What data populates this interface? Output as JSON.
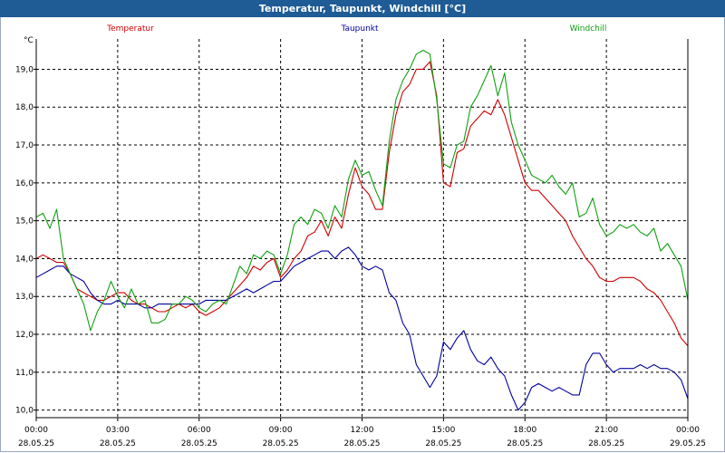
{
  "title": "Temperatur, Taupunkt, Windchill [°C]",
  "chart_data": {
    "type": "line",
    "title": "Temperatur, Taupunkt, Windchill [°C]",
    "ylabel": "°C",
    "xlabel": "",
    "xlim": [
      0,
      24
    ],
    "ylim": [
      9.8,
      19.8
    ],
    "grid": true,
    "legend_position": "top",
    "y_ticks": [
      "10,0",
      "11,0",
      "12,0",
      "13,0",
      "14,0",
      "15,0",
      "16,0",
      "17,0",
      "18,0",
      "19,0"
    ],
    "y_tick_values": [
      10,
      11,
      12,
      13,
      14,
      15,
      16,
      17,
      18,
      19
    ],
    "x_ticks": [
      {
        "time": "00:00",
        "date": "28.05.25"
      },
      {
        "time": "03:00",
        "date": "28.05.25"
      },
      {
        "time": "06:00",
        "date": "28.05.25"
      },
      {
        "time": "09:00",
        "date": "28.05.25"
      },
      {
        "time": "12:00",
        "date": "28.05.25"
      },
      {
        "time": "15:00",
        "date": "28.05.25"
      },
      {
        "time": "18:00",
        "date": "28.05.25"
      },
      {
        "time": "21:00",
        "date": "28.05.25"
      },
      {
        "time": "00:00",
        "date": "29.05.25"
      }
    ],
    "x_tick_values": [
      0,
      3,
      6,
      9,
      12,
      15,
      18,
      21,
      24
    ],
    "series": [
      {
        "name": "Temperatur",
        "color": "#d00000",
        "points": [
          [
            0,
            14.0
          ],
          [
            0.25,
            14.1
          ],
          [
            0.5,
            14.0
          ],
          [
            0.75,
            13.9
          ],
          [
            1.0,
            13.9
          ],
          [
            1.25,
            13.6
          ],
          [
            1.5,
            13.2
          ],
          [
            1.75,
            13.1
          ],
          [
            2.0,
            13.0
          ],
          [
            2.25,
            12.9
          ],
          [
            2.5,
            12.9
          ],
          [
            2.75,
            13.0
          ],
          [
            3.0,
            13.1
          ],
          [
            3.25,
            13.1
          ],
          [
            3.5,
            12.9
          ],
          [
            3.75,
            12.8
          ],
          [
            4.0,
            12.8
          ],
          [
            4.25,
            12.7
          ],
          [
            4.5,
            12.6
          ],
          [
            4.75,
            12.6
          ],
          [
            5.0,
            12.7
          ],
          [
            5.25,
            12.8
          ],
          [
            5.5,
            12.7
          ],
          [
            5.75,
            12.8
          ],
          [
            6.0,
            12.6
          ],
          [
            6.25,
            12.5
          ],
          [
            6.5,
            12.6
          ],
          [
            6.75,
            12.7
          ],
          [
            7.0,
            12.9
          ],
          [
            7.25,
            13.1
          ],
          [
            7.5,
            13.3
          ],
          [
            7.75,
            13.5
          ],
          [
            8.0,
            13.8
          ],
          [
            8.25,
            13.7
          ],
          [
            8.5,
            13.9
          ],
          [
            8.75,
            14.0
          ],
          [
            9.0,
            13.5
          ],
          [
            9.25,
            13.7
          ],
          [
            9.5,
            14.0
          ],
          [
            9.75,
            14.2
          ],
          [
            10.0,
            14.6
          ],
          [
            10.25,
            14.7
          ],
          [
            10.5,
            15.0
          ],
          [
            10.75,
            14.6
          ],
          [
            11.0,
            15.1
          ],
          [
            11.25,
            14.8
          ],
          [
            11.5,
            15.7
          ],
          [
            11.75,
            16.4
          ],
          [
            12.0,
            15.9
          ],
          [
            12.25,
            15.7
          ],
          [
            12.5,
            15.3
          ],
          [
            12.75,
            15.3
          ],
          [
            13.0,
            16.8
          ],
          [
            13.25,
            17.8
          ],
          [
            13.5,
            18.4
          ],
          [
            13.75,
            18.6
          ],
          [
            14.0,
            19.0
          ],
          [
            14.25,
            19.0
          ],
          [
            14.5,
            19.2
          ],
          [
            14.75,
            18.3
          ],
          [
            15.0,
            16.0
          ],
          [
            15.25,
            15.9
          ],
          [
            15.5,
            16.8
          ],
          [
            15.75,
            16.9
          ],
          [
            16.0,
            17.5
          ],
          [
            16.25,
            17.7
          ],
          [
            16.5,
            17.9
          ],
          [
            16.75,
            17.8
          ],
          [
            17.0,
            18.2
          ],
          [
            17.25,
            17.8
          ],
          [
            17.5,
            17.2
          ],
          [
            17.75,
            16.6
          ],
          [
            18.0,
            16.0
          ],
          [
            18.25,
            15.8
          ],
          [
            18.5,
            15.8
          ],
          [
            18.75,
            15.6
          ],
          [
            19.0,
            15.4
          ],
          [
            19.25,
            15.2
          ],
          [
            19.5,
            15.0
          ],
          [
            19.75,
            14.6
          ],
          [
            20.0,
            14.3
          ],
          [
            20.25,
            14.0
          ],
          [
            20.5,
            13.8
          ],
          [
            20.75,
            13.5
          ],
          [
            21.0,
            13.4
          ],
          [
            21.25,
            13.4
          ],
          [
            21.5,
            13.5
          ],
          [
            21.75,
            13.5
          ],
          [
            22.0,
            13.5
          ],
          [
            22.25,
            13.4
          ],
          [
            22.5,
            13.2
          ],
          [
            22.75,
            13.1
          ],
          [
            23.0,
            12.9
          ],
          [
            23.25,
            12.6
          ],
          [
            23.5,
            12.3
          ],
          [
            23.75,
            11.9
          ],
          [
            24.0,
            11.7
          ]
        ]
      },
      {
        "name": "Taupunkt",
        "color": "#0000a0",
        "points": [
          [
            0,
            13.5
          ],
          [
            0.25,
            13.6
          ],
          [
            0.5,
            13.7
          ],
          [
            0.75,
            13.8
          ],
          [
            1.0,
            13.8
          ],
          [
            1.25,
            13.6
          ],
          [
            1.5,
            13.5
          ],
          [
            1.75,
            13.4
          ],
          [
            2.0,
            13.1
          ],
          [
            2.25,
            12.9
          ],
          [
            2.5,
            12.8
          ],
          [
            2.75,
            12.8
          ],
          [
            3.0,
            12.9
          ],
          [
            3.25,
            12.8
          ],
          [
            3.5,
            12.8
          ],
          [
            3.75,
            12.8
          ],
          [
            4.0,
            12.7
          ],
          [
            4.25,
            12.7
          ],
          [
            4.5,
            12.8
          ],
          [
            4.75,
            12.8
          ],
          [
            5.0,
            12.8
          ],
          [
            5.25,
            12.8
          ],
          [
            5.5,
            12.8
          ],
          [
            5.75,
            12.8
          ],
          [
            6.0,
            12.8
          ],
          [
            6.25,
            12.9
          ],
          [
            6.5,
            12.9
          ],
          [
            6.75,
            12.9
          ],
          [
            7.0,
            12.9
          ],
          [
            7.25,
            13.0
          ],
          [
            7.5,
            13.1
          ],
          [
            7.75,
            13.2
          ],
          [
            8.0,
            13.1
          ],
          [
            8.25,
            13.2
          ],
          [
            8.5,
            13.3
          ],
          [
            8.75,
            13.4
          ],
          [
            9.0,
            13.4
          ],
          [
            9.25,
            13.6
          ],
          [
            9.5,
            13.8
          ],
          [
            9.75,
            13.9
          ],
          [
            10.0,
            14.0
          ],
          [
            10.25,
            14.1
          ],
          [
            10.5,
            14.2
          ],
          [
            10.75,
            14.2
          ],
          [
            11.0,
            14.0
          ],
          [
            11.25,
            14.2
          ],
          [
            11.5,
            14.3
          ],
          [
            11.75,
            14.1
          ],
          [
            12.0,
            13.8
          ],
          [
            12.25,
            13.7
          ],
          [
            12.5,
            13.8
          ],
          [
            12.75,
            13.7
          ],
          [
            13.0,
            13.1
          ],
          [
            13.25,
            12.9
          ],
          [
            13.5,
            12.3
          ],
          [
            13.75,
            12.0
          ],
          [
            14.0,
            11.2
          ],
          [
            14.25,
            10.9
          ],
          [
            14.5,
            10.6
          ],
          [
            14.75,
            10.9
          ],
          [
            15.0,
            11.8
          ],
          [
            15.25,
            11.6
          ],
          [
            15.5,
            11.9
          ],
          [
            15.75,
            12.1
          ],
          [
            16.0,
            11.6
          ],
          [
            16.25,
            11.3
          ],
          [
            16.5,
            11.2
          ],
          [
            16.75,
            11.4
          ],
          [
            17.0,
            11.1
          ],
          [
            17.25,
            10.9
          ],
          [
            17.5,
            10.4
          ],
          [
            17.75,
            10.0
          ],
          [
            18.0,
            10.2
          ],
          [
            18.25,
            10.6
          ],
          [
            18.5,
            10.7
          ],
          [
            18.75,
            10.6
          ],
          [
            19.0,
            10.5
          ],
          [
            19.25,
            10.6
          ],
          [
            19.5,
            10.5
          ],
          [
            19.75,
            10.4
          ],
          [
            20.0,
            10.4
          ],
          [
            20.25,
            11.2
          ],
          [
            20.5,
            11.5
          ],
          [
            20.75,
            11.5
          ],
          [
            21.0,
            11.2
          ],
          [
            21.25,
            11.0
          ],
          [
            21.5,
            11.1
          ],
          [
            21.75,
            11.1
          ],
          [
            22.0,
            11.1
          ],
          [
            22.25,
            11.2
          ],
          [
            22.5,
            11.1
          ],
          [
            22.75,
            11.2
          ],
          [
            23.0,
            11.1
          ],
          [
            23.25,
            11.1
          ],
          [
            23.5,
            11.0
          ],
          [
            23.75,
            10.8
          ],
          [
            24.0,
            10.3
          ]
        ]
      },
      {
        "name": "Windchill",
        "color": "#10a010",
        "points": [
          [
            0,
            15.1
          ],
          [
            0.25,
            15.2
          ],
          [
            0.5,
            14.8
          ],
          [
            0.75,
            15.3
          ],
          [
            1.0,
            14.0
          ],
          [
            1.25,
            13.6
          ],
          [
            1.5,
            13.2
          ],
          [
            1.75,
            12.8
          ],
          [
            2.0,
            12.1
          ],
          [
            2.25,
            12.6
          ],
          [
            2.5,
            12.9
          ],
          [
            2.75,
            13.4
          ],
          [
            3.0,
            13.0
          ],
          [
            3.25,
            12.7
          ],
          [
            3.5,
            13.2
          ],
          [
            3.75,
            12.8
          ],
          [
            4.0,
            12.9
          ],
          [
            4.25,
            12.3
          ],
          [
            4.5,
            12.3
          ],
          [
            4.75,
            12.4
          ],
          [
            5.0,
            12.8
          ],
          [
            5.25,
            12.8
          ],
          [
            5.5,
            13.0
          ],
          [
            5.75,
            12.9
          ],
          [
            6.0,
            12.7
          ],
          [
            6.25,
            12.6
          ],
          [
            6.5,
            12.8
          ],
          [
            6.75,
            12.9
          ],
          [
            7.0,
            12.8
          ],
          [
            7.25,
            13.3
          ],
          [
            7.5,
            13.8
          ],
          [
            7.75,
            13.6
          ],
          [
            8.0,
            14.1
          ],
          [
            8.25,
            14.0
          ],
          [
            8.5,
            14.2
          ],
          [
            8.75,
            14.1
          ],
          [
            9.0,
            13.6
          ],
          [
            9.25,
            14.1
          ],
          [
            9.5,
            14.9
          ],
          [
            9.75,
            15.1
          ],
          [
            10.0,
            14.9
          ],
          [
            10.25,
            15.3
          ],
          [
            10.5,
            15.2
          ],
          [
            10.75,
            14.8
          ],
          [
            11.0,
            15.4
          ],
          [
            11.25,
            15.1
          ],
          [
            11.5,
            16.1
          ],
          [
            11.75,
            16.6
          ],
          [
            12.0,
            16.2
          ],
          [
            12.25,
            16.3
          ],
          [
            12.5,
            15.8
          ],
          [
            12.75,
            15.4
          ],
          [
            13.0,
            17.1
          ],
          [
            13.25,
            18.2
          ],
          [
            13.5,
            18.7
          ],
          [
            13.75,
            19.0
          ],
          [
            14.0,
            19.4
          ],
          [
            14.25,
            19.5
          ],
          [
            14.5,
            19.4
          ],
          [
            14.75,
            18.2
          ],
          [
            15.0,
            16.5
          ],
          [
            15.25,
            16.4
          ],
          [
            15.5,
            17.0
          ],
          [
            15.75,
            17.1
          ],
          [
            16.0,
            18.0
          ],
          [
            16.25,
            18.3
          ],
          [
            16.5,
            18.7
          ],
          [
            16.75,
            19.1
          ],
          [
            17.0,
            18.3
          ],
          [
            17.25,
            18.9
          ],
          [
            17.5,
            17.6
          ],
          [
            17.75,
            17.0
          ],
          [
            18.0,
            16.6
          ],
          [
            18.25,
            16.2
          ],
          [
            18.5,
            16.1
          ],
          [
            18.75,
            16.0
          ],
          [
            19.0,
            16.2
          ],
          [
            19.25,
            15.9
          ],
          [
            19.5,
            15.7
          ],
          [
            19.75,
            16.0
          ],
          [
            20.0,
            15.1
          ],
          [
            20.25,
            15.2
          ],
          [
            20.5,
            15.6
          ],
          [
            20.75,
            14.9
          ],
          [
            21.0,
            14.6
          ],
          [
            21.25,
            14.7
          ],
          [
            21.5,
            14.9
          ],
          [
            21.75,
            14.8
          ],
          [
            22.0,
            14.9
          ],
          [
            22.25,
            14.7
          ],
          [
            22.5,
            14.6
          ],
          [
            22.75,
            14.8
          ],
          [
            23.0,
            14.2
          ],
          [
            23.25,
            14.4
          ],
          [
            23.5,
            14.1
          ],
          [
            23.75,
            13.8
          ],
          [
            24.0,
            12.9
          ]
        ]
      }
    ]
  }
}
